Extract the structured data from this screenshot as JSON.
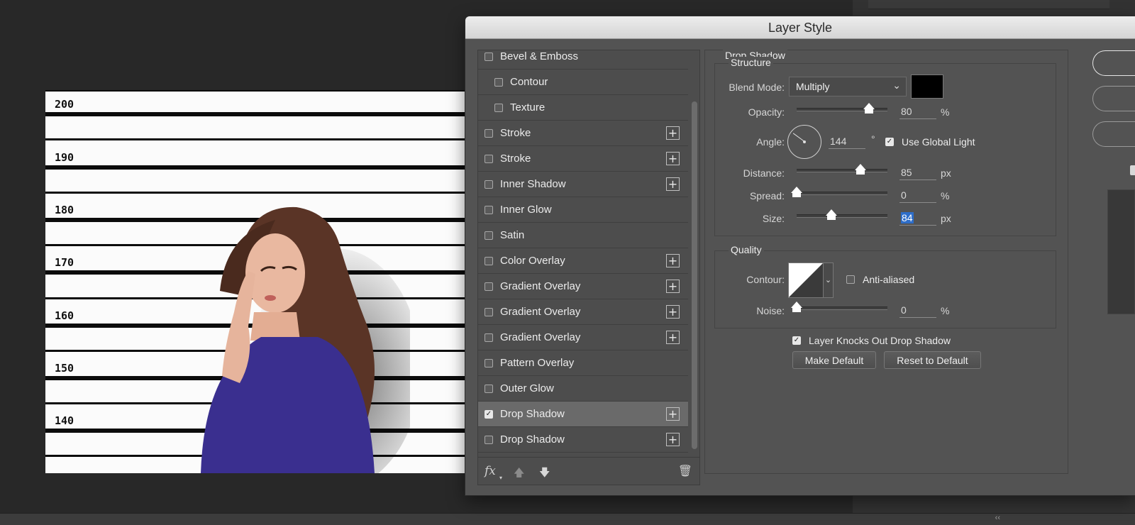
{
  "canvas": {
    "labels": [
      "200",
      "190",
      "180",
      "170",
      "160",
      "150",
      "140"
    ]
  },
  "dialog": {
    "title": "Layer Style",
    "styles": [
      {
        "label": "Bevel & Emboss",
        "checked": false,
        "plus": false,
        "indent": false,
        "selected": false
      },
      {
        "label": "Contour",
        "checked": false,
        "plus": false,
        "indent": true,
        "selected": false
      },
      {
        "label": "Texture",
        "checked": false,
        "plus": false,
        "indent": true,
        "selected": false
      },
      {
        "label": "Stroke",
        "checked": false,
        "plus": true,
        "indent": false,
        "selected": false
      },
      {
        "label": "Stroke",
        "checked": false,
        "plus": true,
        "indent": false,
        "selected": false
      },
      {
        "label": "Inner Shadow",
        "checked": false,
        "plus": true,
        "indent": false,
        "selected": false
      },
      {
        "label": "Inner Glow",
        "checked": false,
        "plus": false,
        "indent": false,
        "selected": false
      },
      {
        "label": "Satin",
        "checked": false,
        "plus": false,
        "indent": false,
        "selected": false
      },
      {
        "label": "Color Overlay",
        "checked": false,
        "plus": true,
        "indent": false,
        "selected": false
      },
      {
        "label": "Gradient Overlay",
        "checked": false,
        "plus": true,
        "indent": false,
        "selected": false
      },
      {
        "label": "Gradient Overlay",
        "checked": false,
        "plus": true,
        "indent": false,
        "selected": false
      },
      {
        "label": "Gradient Overlay",
        "checked": false,
        "plus": true,
        "indent": false,
        "selected": false
      },
      {
        "label": "Pattern Overlay",
        "checked": false,
        "plus": false,
        "indent": false,
        "selected": false
      },
      {
        "label": "Outer Glow",
        "checked": false,
        "plus": false,
        "indent": false,
        "selected": false
      },
      {
        "label": "Drop Shadow",
        "checked": true,
        "plus": true,
        "indent": false,
        "selected": true
      },
      {
        "label": "Drop Shadow",
        "checked": false,
        "plus": true,
        "indent": false,
        "selected": false
      }
    ],
    "footer": {
      "fx_label": "fx"
    },
    "drop_shadow": {
      "title": "Drop Shadow",
      "structure": {
        "title": "Structure",
        "blend_mode_label": "Blend Mode:",
        "blend_mode_value": "Multiply",
        "shadow_color": "#000000",
        "opacity_label": "Opacity:",
        "opacity_value": "80",
        "opacity_unit": "%",
        "opacity_level": 0.8,
        "angle_label": "Angle:",
        "angle_value": "144",
        "angle_unit": "°",
        "use_global_light_label": "Use Global Light",
        "use_global_light": true,
        "distance_label": "Distance:",
        "distance_value": "85",
        "distance_unit": "px",
        "distance_level": 0.7,
        "spread_label": "Spread:",
        "spread_value": "0",
        "spread_unit": "%",
        "spread_level": 0.0,
        "size_label": "Size:",
        "size_value": "84",
        "size_unit": "px",
        "size_level": 0.38
      },
      "quality": {
        "title": "Quality",
        "contour_label": "Contour:",
        "anti_aliased_label": "Anti-aliased",
        "anti_aliased": false,
        "noise_label": "Noise:",
        "noise_value": "0",
        "noise_unit": "%",
        "noise_level": 0.0
      },
      "knocks_out_label": "Layer Knocks Out Drop Shadow",
      "knocks_out": true,
      "make_default_label": "Make Default",
      "reset_default_label": "Reset to Default"
    }
  }
}
